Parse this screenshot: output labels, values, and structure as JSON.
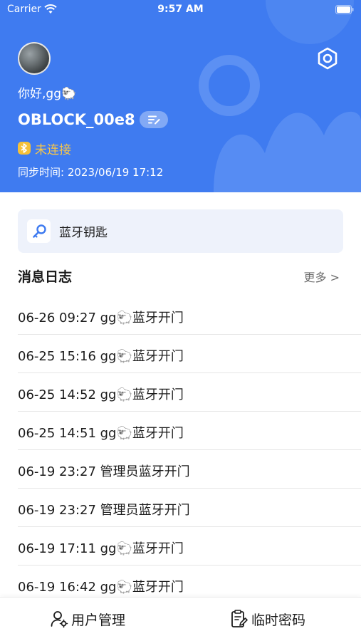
{
  "status_bar": {
    "carrier": "Carrier",
    "time": "9:57 AM"
  },
  "header": {
    "greeting": "你好,gg🐑",
    "device_name": "OBLOCK_00e8",
    "connection_status": "未连接",
    "sync_time": "同步时间: 2023/06/19 17:12",
    "brand_color": "#3f7bf0",
    "status_color": "#f5c13a"
  },
  "key_card": {
    "label": "蓝牙钥匙"
  },
  "log": {
    "title": "消息日志",
    "more": "更多 >",
    "entries": [
      "06-26 09:27 gg🐑蓝牙开门",
      "06-25 15:16 gg🐑蓝牙开门",
      "06-25 14:52 gg🐑蓝牙开门",
      "06-25 14:51 gg🐑蓝牙开门",
      "06-19 23:27 管理员蓝牙开门",
      "06-19 23:27 管理员蓝牙开门",
      "06-19 17:11 gg🐑蓝牙开门",
      "06-19 16:42 gg🐑蓝牙开门"
    ]
  },
  "tabbar": {
    "users_label": "用户管理",
    "temp_password_label": "临时密码"
  },
  "icons": {
    "wifi": "wifi-icon",
    "battery": "battery-icon",
    "settings": "settings-hexagon-icon",
    "rename": "edit-list-icon",
    "bluetooth": "bluetooth-icon",
    "key": "key-icon",
    "users": "user-gear-icon",
    "temp_password": "clipboard-edit-icon"
  }
}
